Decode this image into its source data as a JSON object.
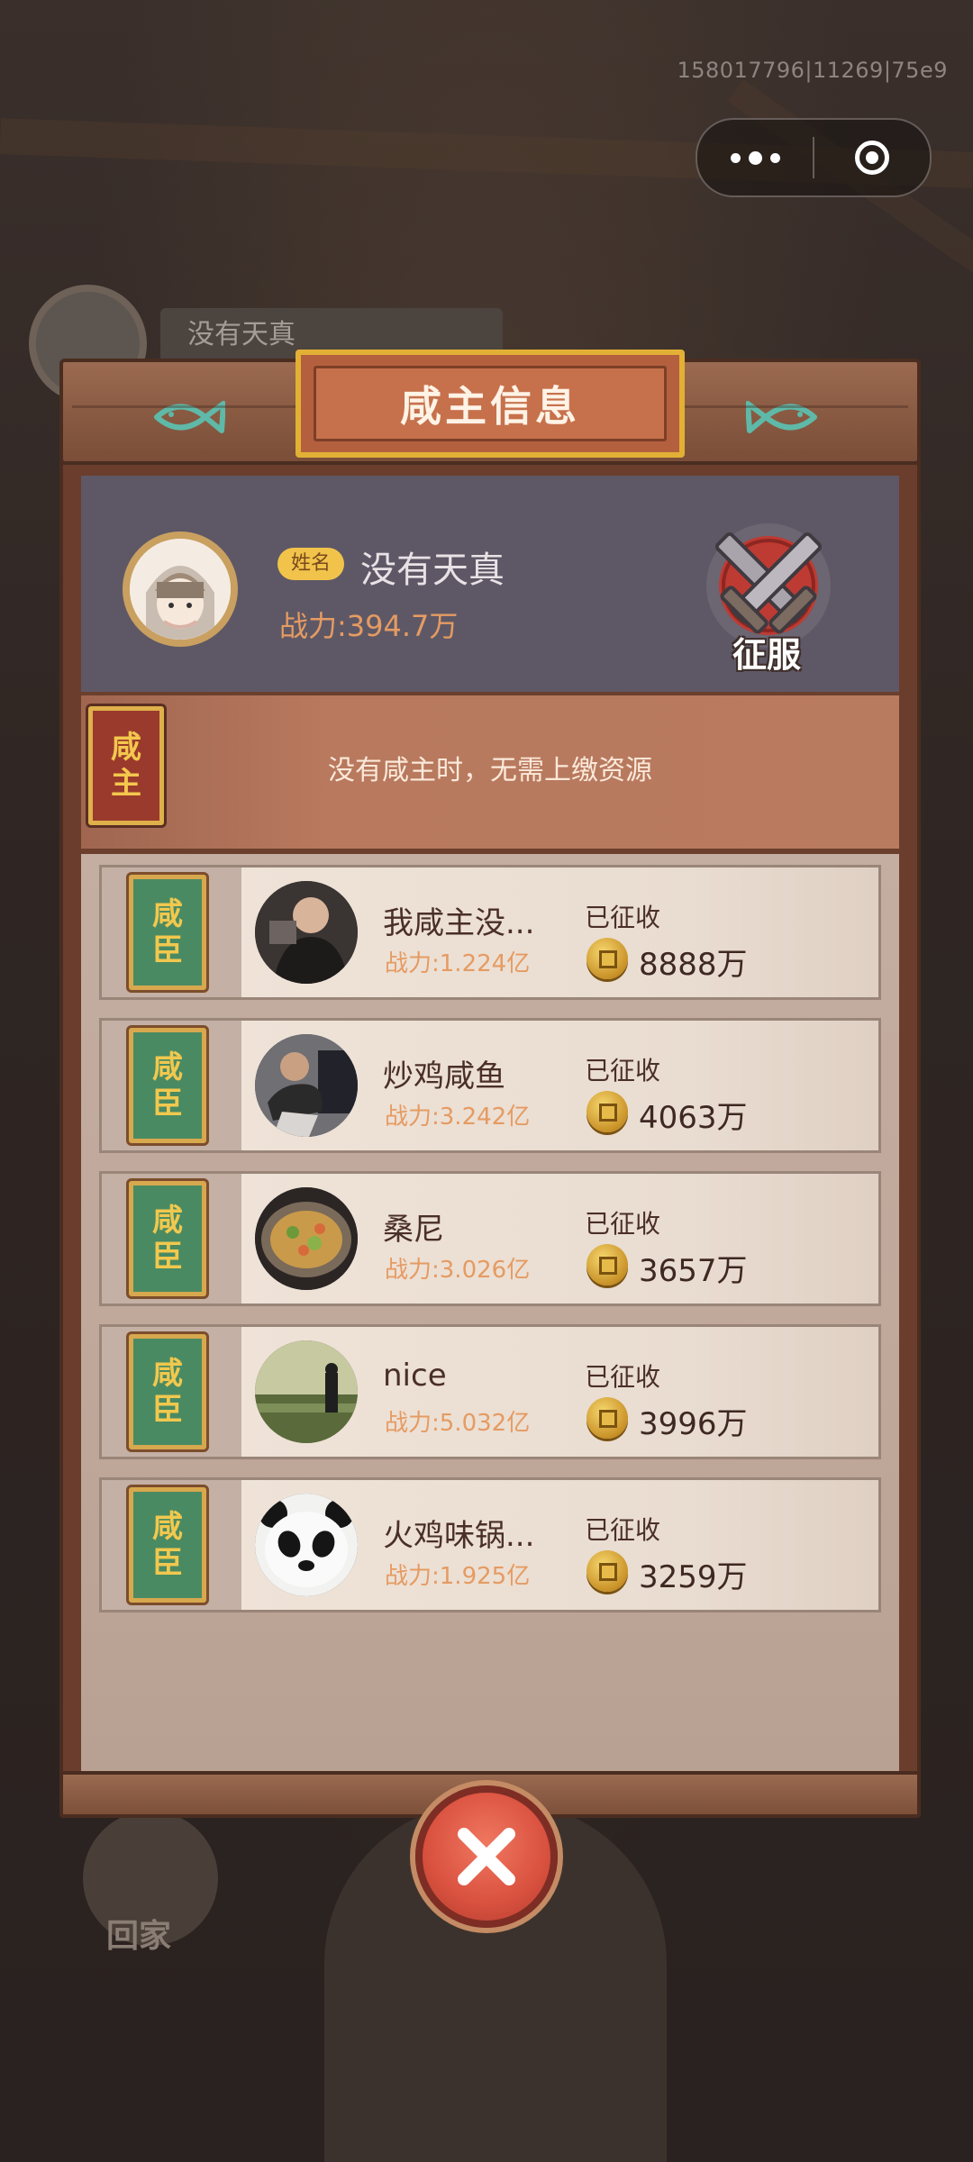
{
  "status": {
    "version_id": "158017796|11269|75e9"
  },
  "capsule": {
    "more_icon": "more-dots-icon",
    "close_icon": "target-close-icon"
  },
  "background": {
    "player_name": "没有天真",
    "home_label": "回家"
  },
  "dialog": {
    "title": "咸主信息",
    "profile": {
      "name_badge": "姓名",
      "name": "没有天真",
      "power": "战力:394.7万",
      "conquer_label": "征服"
    },
    "lord": {
      "tag_chars": [
        "咸",
        "主"
      ],
      "message": "没有咸主时，无需上缴资源"
    },
    "vassals": [
      {
        "tag_chars": [
          "咸",
          "臣"
        ],
        "name": "我咸主没...",
        "power": "战力:1.224亿",
        "collected_label": "已征收",
        "amount": "8888万",
        "avatar_icon": "person-photo-avatar"
      },
      {
        "tag_chars": [
          "咸",
          "臣"
        ],
        "name": "炒鸡咸鱼",
        "power": "战力:3.242亿",
        "collected_label": "已征收",
        "amount": "4063万",
        "avatar_icon": "athlete-photo-avatar"
      },
      {
        "tag_chars": [
          "咸",
          "臣"
        ],
        "name": "桑尼",
        "power": "战力:3.026亿",
        "collected_label": "已征收",
        "amount": "3657万",
        "avatar_icon": "food-photo-avatar"
      },
      {
        "tag_chars": [
          "咸",
          "臣"
        ],
        "name": "nice",
        "power": "战力:5.032亿",
        "collected_label": "已征收",
        "amount": "3996万",
        "avatar_icon": "landscape-photo-avatar"
      },
      {
        "tag_chars": [
          "咸",
          "臣"
        ],
        "name": "火鸡味锅...",
        "power": "战力:1.925亿",
        "collected_label": "已征收",
        "amount": "3259万",
        "avatar_icon": "panda-photo-avatar"
      }
    ],
    "close_icon": "close-x-icon"
  },
  "colors": {
    "accent_orange": "#e59b62",
    "tag_gold": "#f1c84e",
    "lord_red": "#9a3a2c",
    "vassal_green": "#4a8a62",
    "close_red": "#d9513f"
  }
}
